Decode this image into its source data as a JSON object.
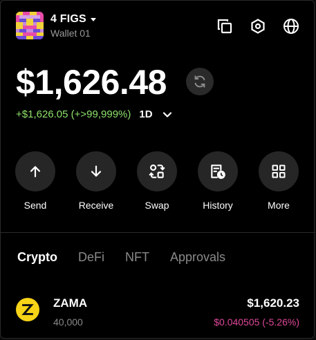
{
  "wallet": {
    "name": "4 FIGS",
    "subtitle": "Wallet 01"
  },
  "header_icons": [
    "copy-icon",
    "settings-hexagon-icon",
    "globe-icon"
  ],
  "balance": {
    "total": "$1,626.48",
    "change": "+$1,626.05 (+>99,999%)",
    "period": "1D",
    "change_color": "#8fe36c"
  },
  "actions": [
    {
      "label": "Send",
      "icon": "arrow-up-icon"
    },
    {
      "label": "Receive",
      "icon": "arrow-down-icon"
    },
    {
      "label": "Swap",
      "icon": "swap-icon"
    },
    {
      "label": "History",
      "icon": "history-icon"
    },
    {
      "label": "More",
      "icon": "grid-icon"
    }
  ],
  "tabs": [
    {
      "label": "Crypto",
      "active": true
    },
    {
      "label": "DeFi",
      "active": false
    },
    {
      "label": "NFT",
      "active": false
    },
    {
      "label": "Approvals",
      "active": false
    }
  ],
  "tokens": [
    {
      "name": "ZAMA",
      "amount": "40,000",
      "value": "$1,620.23",
      "price_change": "$0.040505 (-5.26%)",
      "logo_color": "#f7d417",
      "price_change_color": "#e0489a"
    }
  ]
}
